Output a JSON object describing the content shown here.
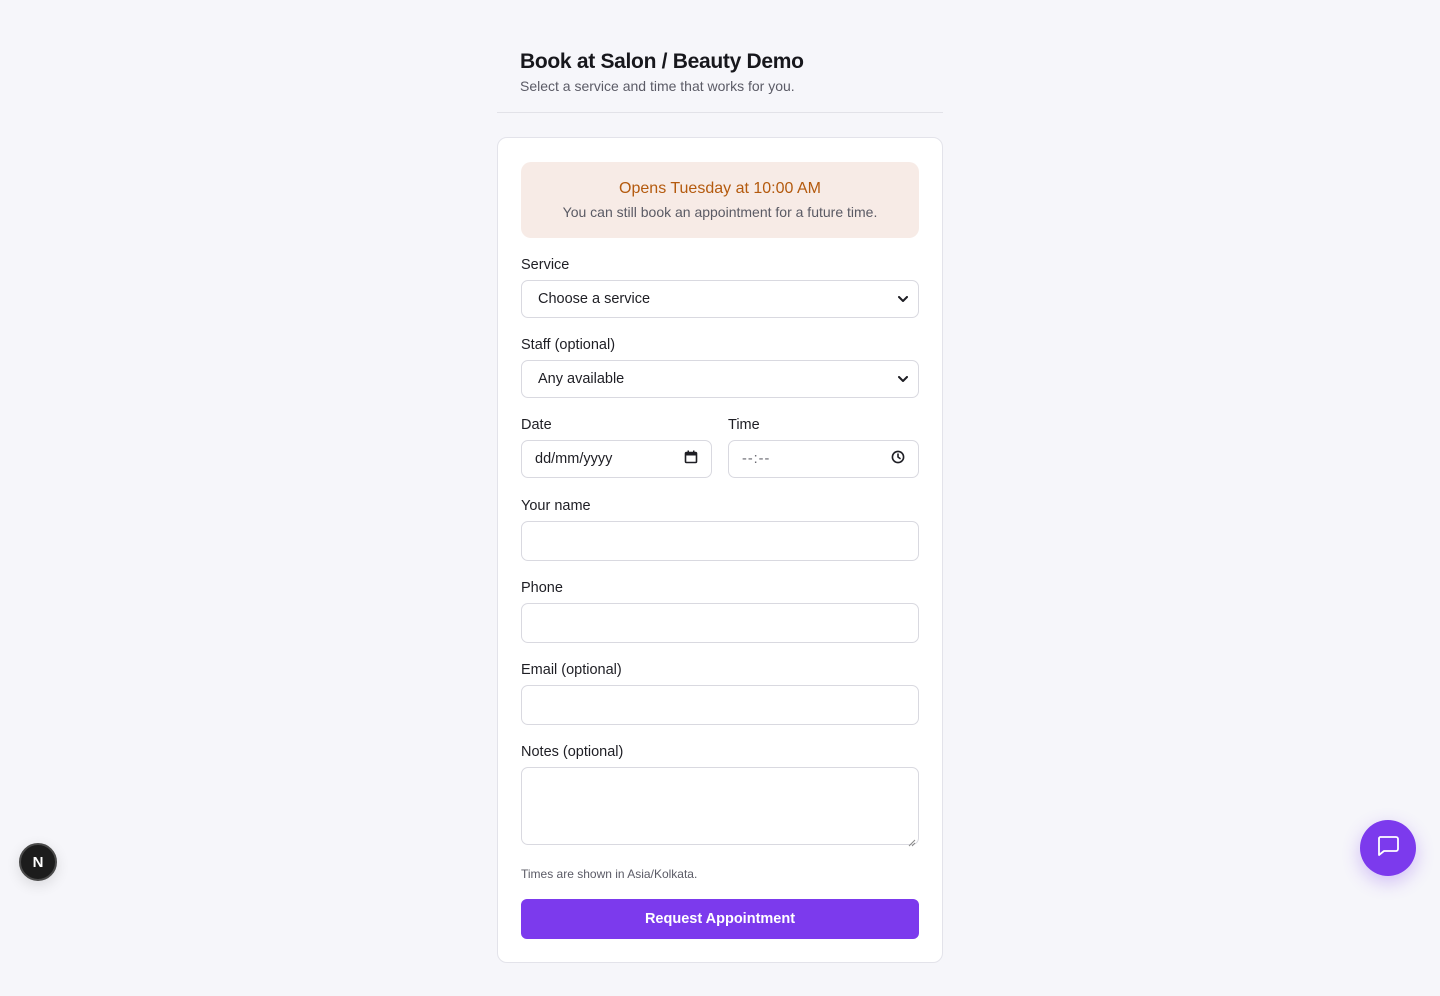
{
  "header": {
    "title": "Book at Salon / Beauty Demo",
    "subtitle": "Select a service and time that works for you."
  },
  "notice": {
    "title": "Opens Tuesday at 10:00 AM",
    "text": "You can still book an appointment for a future time."
  },
  "form": {
    "service": {
      "label": "Service",
      "value": "Choose a service"
    },
    "staff": {
      "label": "Staff (optional)",
      "value": "Any available"
    },
    "date": {
      "label": "Date",
      "placeholder": "dd/mm/yyyy"
    },
    "time": {
      "label": "Time",
      "placeholder": "--:--"
    },
    "name": {
      "label": "Your name",
      "value": ""
    },
    "phone": {
      "label": "Phone",
      "value": ""
    },
    "email": {
      "label": "Email (optional)",
      "value": ""
    },
    "notes": {
      "label": "Notes (optional)",
      "value": ""
    },
    "timezone_note": "Times are shown in Asia/Kolkata.",
    "submit_label": "Request Appointment"
  },
  "badges": {
    "next_letter": "N"
  },
  "colors": {
    "accent": "#7c3aed",
    "notice_bg": "#f7ebe6",
    "notice_text": "#b45a0e",
    "page_bg": "#f6f6fa"
  },
  "icons": {
    "select_chevron": "chevron-down-icon",
    "date": "calendar-icon",
    "time": "clock-icon",
    "chat": "chat-bubble-icon",
    "next": "nextjs-logo-icon"
  }
}
